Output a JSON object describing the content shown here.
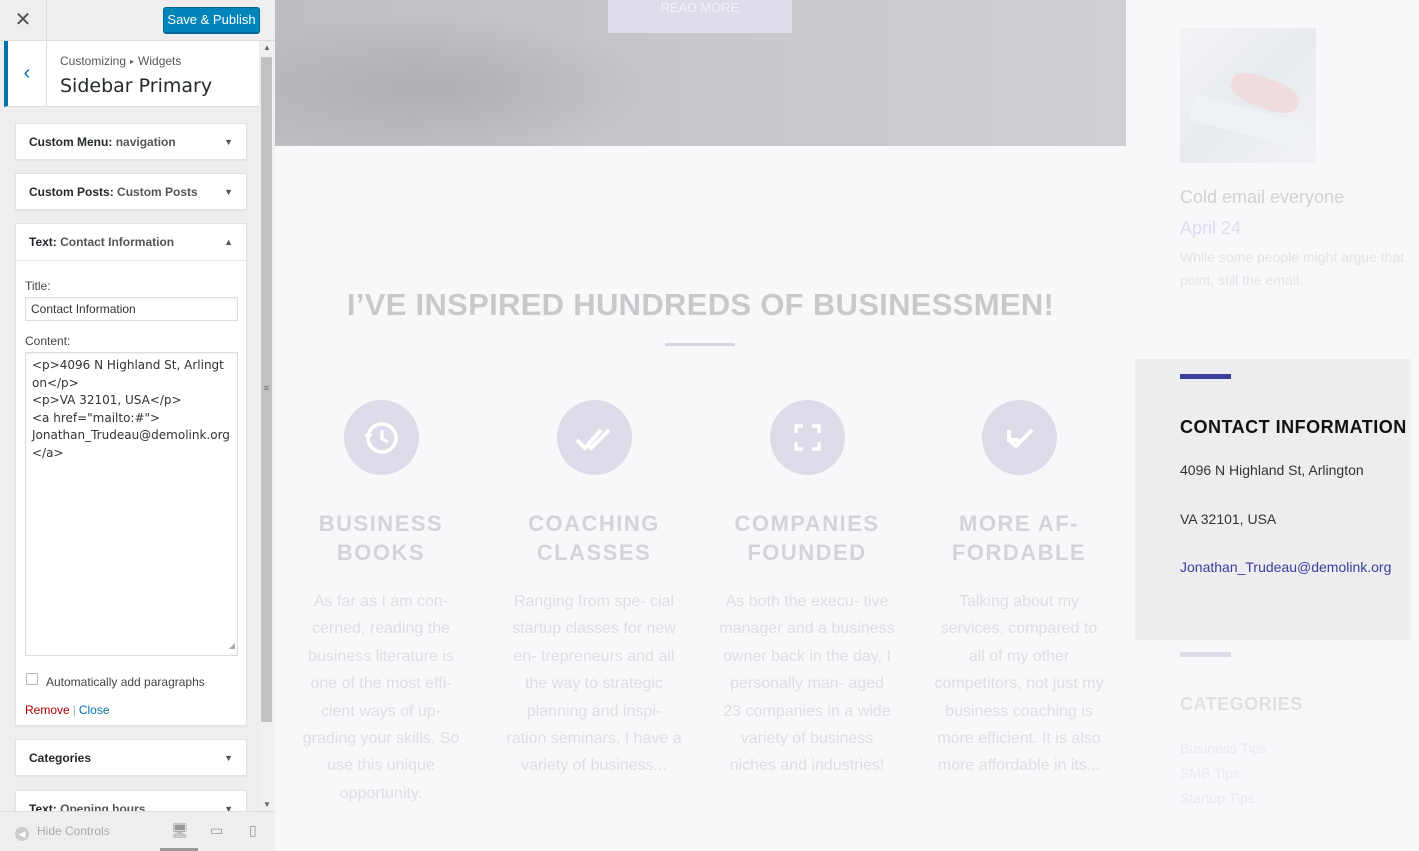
{
  "header": {
    "close_icon": "close-icon",
    "save_label": "Save & Publish",
    "save_color": "#0085ba"
  },
  "section": {
    "breadcrumb_parent": "Customizing",
    "breadcrumb_child": "Widgets",
    "title": "Sidebar Primary",
    "accent_color": "#0073aa"
  },
  "widgets": [
    {
      "type": "Custom Menu",
      "subtitle": "navigation"
    },
    {
      "type": "Custom Posts",
      "subtitle": "Custom Posts"
    },
    {
      "type": "Text",
      "subtitle": "Contact Information"
    },
    {
      "type": "Categories",
      "subtitle": ""
    },
    {
      "type": "Text",
      "subtitle": "Opening hours"
    }
  ],
  "text_widget": {
    "title_label": "Title:",
    "title_value": "Contact Information",
    "content_label": "Content:",
    "content_value": "<p>4096 N Highland St, Arlington</p>\n<p>VA 32101, USA</p>\n<a href=\"mailto:#\">\nJonathan_Trudeau@demolink.org</a>",
    "autop_label": "Automatically add paragraphs",
    "autop_checked": false,
    "remove_label": "Remove",
    "close_label": "Close"
  },
  "footer": {
    "hide_controls_label": "Hide Controls",
    "devices": [
      "desktop-icon",
      "tablet-icon",
      "mobile-icon"
    ],
    "active_device": "desktop"
  },
  "preview": {
    "read_more": "READ MORE",
    "headline": "I’VE INSPIRED HUNDREDS OF BUSINESSMEN!",
    "features": [
      {
        "icon": "history-icon",
        "title_1": "BUSINESS",
        "title_2": "BOOKS",
        "text": "As far as I am con- cerned, reading the business literature is one of the most effi- cient ways of up- grading your skills. So use this unique opportunity."
      },
      {
        "icon": "double-check-icon",
        "title_1": "COACHING",
        "title_2": "CLASSES",
        "text": "Ranging from spe- cial startup classes for new en- trepreneurs and all the way to strategic planning and inspi- ration seminars, I have a variety of business..."
      },
      {
        "icon": "expand-icon",
        "title_1": "COMPANIES",
        "title_2": "FOUNDED",
        "text": "As both the execu- tive manager and a business owner back in the day, I personally man- aged 23 companies in a wide variety of business niches and industries!"
      },
      {
        "icon": "arrow-check-icon",
        "title_1": "MORE AF-",
        "title_2": "FORDABLE",
        "text": "Talking about my services, compared to all of my other competitors, not just my business coaching is more efficient. It is also more affordable in its..."
      }
    ],
    "post": {
      "title": "Cold email everyone",
      "date": "April 24",
      "excerpt": "While some people might argue that point, still the email."
    },
    "contact": {
      "title": "CONTACT INFORMATION",
      "address": "4096 N Highland St, Arlington",
      "region": "VA 32101, USA",
      "email": "Jonathan_Trudeau@demolink.org",
      "accent_color": "#3a3e9a"
    },
    "categories": {
      "title": "CATEGORIES",
      "items": [
        "Business Tips",
        "SMB Tips",
        "Startup Tips"
      ]
    }
  }
}
